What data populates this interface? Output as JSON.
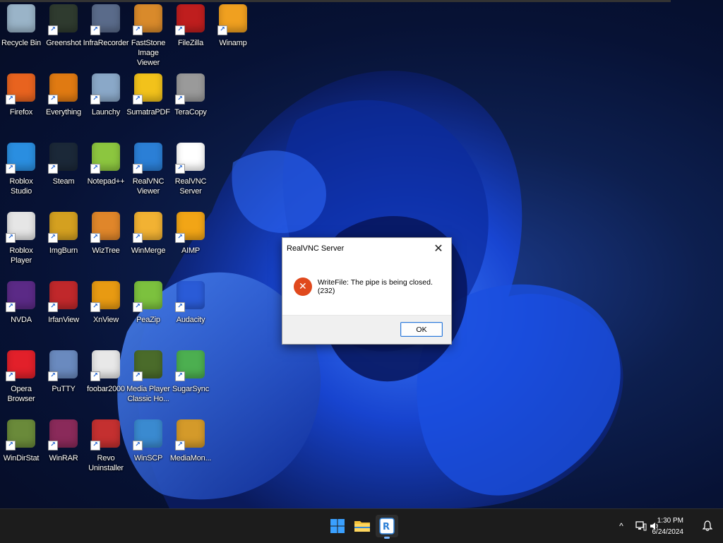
{
  "desktop": {
    "icons": [
      {
        "label": "Recycle Bin",
        "icon": "recycle-bin-icon",
        "color": "#9ab4c8"
      },
      {
        "label": "Greenshot",
        "icon": "greenshot-icon",
        "color": "#2f3b2f"
      },
      {
        "label": "InfraRecorder",
        "icon": "infrarecorder-icon",
        "color": "#5a6b8a"
      },
      {
        "label": "FastStone Image Viewer",
        "icon": "faststone-icon",
        "color": "#d98a2b"
      },
      {
        "label": "FileZilla",
        "icon": "filezilla-icon",
        "color": "#bf1e1e"
      },
      {
        "label": "Winamp",
        "icon": "winamp-icon",
        "color": "#f0a020"
      },
      {
        "label": "Firefox",
        "icon": "firefox-icon",
        "color": "#e8631f"
      },
      {
        "label": "Everything",
        "icon": "everything-icon",
        "color": "#e07a12"
      },
      {
        "label": "Launchy",
        "icon": "launchy-icon",
        "color": "#8aa8c8"
      },
      {
        "label": "SumatraPDF",
        "icon": "sumatrapdf-icon",
        "color": "#f2c21b"
      },
      {
        "label": "TeraCopy",
        "icon": "teracopy-icon",
        "color": "#9a9a9a"
      },
      {
        "label": "Roblox Studio",
        "icon": "roblox-studio-icon",
        "color": "#2a8ee0"
      },
      {
        "label": "Steam",
        "icon": "steam-icon",
        "color": "#1b2838"
      },
      {
        "label": "Notepad++",
        "icon": "notepadpp-icon",
        "color": "#8cc63f"
      },
      {
        "label": "RealVNC Viewer",
        "icon": "realvnc-viewer-icon",
        "color": "#2b7fd6"
      },
      {
        "label": "RealVNC Server",
        "icon": "realvnc-server-icon",
        "color": "#ffffff"
      },
      {
        "label": "Roblox Player",
        "icon": "roblox-player-icon",
        "color": "#e6e6e6"
      },
      {
        "label": "ImgBurn",
        "icon": "imgburn-icon",
        "color": "#d4a020"
      },
      {
        "label": "WizTree",
        "icon": "wiztree-icon",
        "color": "#e0862a"
      },
      {
        "label": "WinMerge",
        "icon": "winmerge-icon",
        "color": "#f2b233"
      },
      {
        "label": "AIMP",
        "icon": "aimp-icon",
        "color": "#f2a516"
      },
      {
        "label": "NVDA",
        "icon": "nvda-icon",
        "color": "#5b2a86"
      },
      {
        "label": "IrfanView",
        "icon": "irfanview-icon",
        "color": "#c0282b"
      },
      {
        "label": "XnView",
        "icon": "xnview-icon",
        "color": "#e89a12"
      },
      {
        "label": "PeaZip",
        "icon": "peazip-icon",
        "color": "#7cc13e"
      },
      {
        "label": "Audacity",
        "icon": "audacity-icon",
        "color": "#2a5bd7"
      },
      {
        "label": "Opera Browser",
        "icon": "opera-icon",
        "color": "#e2202a"
      },
      {
        "label": "PuTTY",
        "icon": "putty-icon",
        "color": "#6a8abf"
      },
      {
        "label": "foobar2000",
        "icon": "foobar2000-icon",
        "color": "#e8e8e8"
      },
      {
        "label": "Media Player Classic Ho...",
        "icon": "mpc-hc-icon",
        "color": "#4a6b2a"
      },
      {
        "label": "SugarSync",
        "icon": "sugarsync-icon",
        "color": "#4caf50"
      },
      {
        "label": "WinDirStat",
        "icon": "windirstat-icon",
        "color": "#6a8a3a"
      },
      {
        "label": "WinRAR",
        "icon": "winrar-icon",
        "color": "#8a2a5a"
      },
      {
        "label": "Revo Uninstaller",
        "icon": "revo-uninstaller-icon",
        "color": "#c43030"
      },
      {
        "label": "WinSCP",
        "icon": "winscp-icon",
        "color": "#3a8ad0"
      },
      {
        "label": "MediaMon...",
        "icon": "mediamonkey-icon",
        "color": "#d49a2a"
      }
    ]
  },
  "dialog": {
    "title": "RealVNC Server",
    "close_glyph": "✕",
    "error_glyph": "✕",
    "message": "WriteFile: The pipe is being closed. (232)",
    "ok_label": "OK"
  },
  "taskbar": {
    "apps": [
      {
        "name": "start-button",
        "icon": "windows-logo-icon"
      },
      {
        "name": "taskbar-file-explorer",
        "icon": "folder-icon"
      },
      {
        "name": "taskbar-realvnc-server",
        "icon": "realvnc-icon"
      }
    ],
    "tray": {
      "chevron": "^",
      "time": "1:30 PM",
      "date": "6/24/2024"
    }
  },
  "colors": {
    "taskbar_bg": "#1c1c1c",
    "accent": "#2b78d8",
    "error": "#e0491d"
  }
}
